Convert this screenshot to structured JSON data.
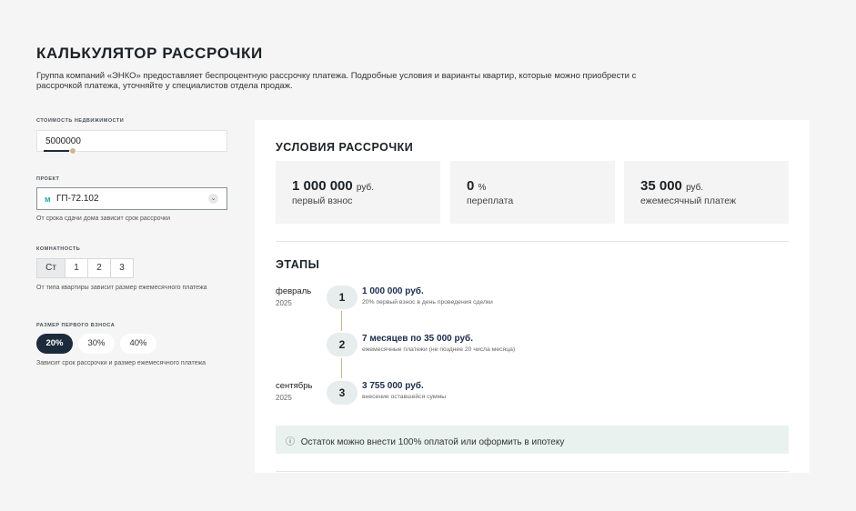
{
  "page": {
    "title": "КАЛЬКУЛЯТОР РАССРОЧКИ",
    "subtitle": "Группа компаний «ЭНКО» предоставляет беспроцентную рассрочку платежа. Подробные условия и варианты квартир, которые можно приобрести с рассрочкой платежа, уточняйте у специалистов отдела продаж."
  },
  "form": {
    "price": {
      "label": "СТОИМОСТЬ НЕДВИЖИМОСТИ",
      "value": "5000000"
    },
    "project": {
      "label": "ПРОЕКТ",
      "logo": "ᴍ",
      "value": "ГП-72.102",
      "hint": "От срока сдачи дома зависит срок рассрочки"
    },
    "rooms": {
      "label": "КОМНАТНОСТЬ",
      "options": [
        "Ст",
        "1",
        "2",
        "3"
      ],
      "selected": "Ст",
      "hint": "От типа квартиры зависит размер ежемесячного платежа"
    },
    "down_payment": {
      "label": "РАЗМЕР ПЕРВОГО ВЗНОСА",
      "options": [
        "20%",
        "30%",
        "40%"
      ],
      "selected": "20%",
      "hint": "Зависит срок рассрочки и размер ежемесячного платежа"
    }
  },
  "conditions": {
    "title": "УСЛОВИЯ РАССРОЧКИ",
    "cards": [
      {
        "value": "1 000 000",
        "unit": "руб.",
        "caption": "первый взнос"
      },
      {
        "value": "0",
        "unit": "%",
        "caption": "переплата"
      },
      {
        "value": "35 000",
        "unit": "руб.",
        "caption": "ежемесячный платеж"
      }
    ]
  },
  "stages": {
    "title": "ЭТАПЫ",
    "items": [
      {
        "month": "февраль",
        "year": "2025",
        "num": "1",
        "heading": "1 000 000 руб.",
        "desc": "20% первый взнос в день проведения сделки"
      },
      {
        "month": "",
        "year": "",
        "num": "2",
        "heading": "7 месяцев по 35 000 руб.",
        "desc": "ежемесячные платежи (не позднее 20 числа месяца)"
      },
      {
        "month": "сентябрь",
        "year": "2025",
        "num": "3",
        "heading": "3 755 000 руб.",
        "desc": "внесение оставшейся суммы"
      }
    ],
    "notice": "Остаток можно внести 100% оплатой или оформить в ипотеку",
    "notice_icon": "ⓘ"
  },
  "colors": {
    "accent_dark": "#1c2b3c",
    "accent_gold": "#c9b98c",
    "notice_bg": "#e9f2ef"
  }
}
